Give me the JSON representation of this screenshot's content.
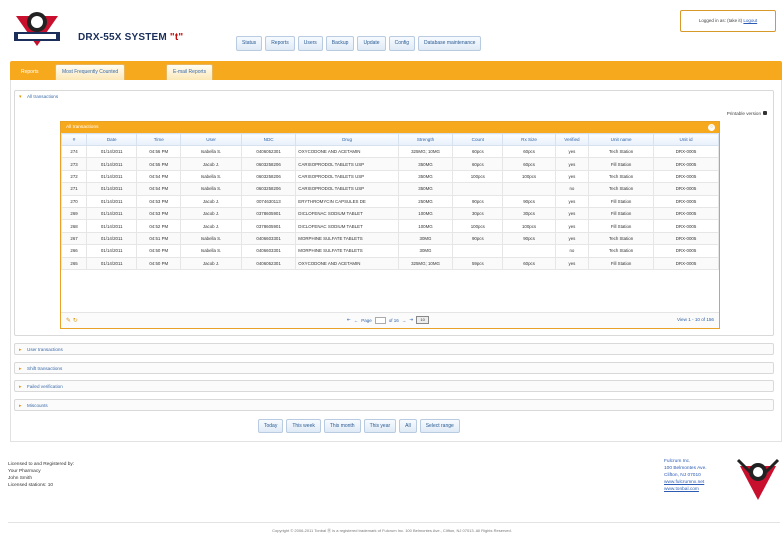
{
  "header": {
    "app_title": "DRX-55X SYSTEM",
    "app_title_mark": "\"t\"",
    "nav": [
      "Status",
      "Reports",
      "Users",
      "Backup",
      "Update",
      "Config",
      "Database maintenance"
    ],
    "login_text": "Logged in as: (take it)",
    "login_link": "Logout"
  },
  "tabs": [
    "Reports",
    "Most Frequently Counted",
    "E-mail Reports"
  ],
  "sections": {
    "open_label": "All transactions",
    "collapsed": [
      "User transactions",
      "Shift transactions",
      "Failed verification",
      "Miscounts"
    ]
  },
  "printable_label": "Printable version",
  "grid": {
    "caption": "All transactions",
    "columns": [
      "#",
      "Date",
      "Time",
      "User",
      "NDC",
      "Drug",
      "Strength",
      "Count",
      "Rx Size",
      "Verified",
      "Unit name",
      "Unit id"
    ],
    "rows": [
      [
        "274",
        "01/14/2011",
        "04:56 PM",
        "Isabella S.",
        "0406052301",
        "OXYCODONE AND ACETAMIN",
        "325MG; 10MG",
        "60pcs",
        "60pcs",
        "yes",
        "Tech Station",
        "DRX-0005"
      ],
      [
        "273",
        "01/14/2011",
        "04:55 PM",
        "Jacob J.",
        "0603258206",
        "CARISOPRODOL TABLETS USP",
        "350MG",
        "60pcs",
        "60pcs",
        "yes",
        "Fill Station",
        "DRX-0005"
      ],
      [
        "272",
        "01/14/2011",
        "04:54 PM",
        "Isabella S.",
        "0603258206",
        "CARISOPRODOL TABLETS USP",
        "350MG",
        "100pcs",
        "100pcs",
        "yes",
        "Tech Station",
        "DRX-0005"
      ],
      [
        "271",
        "01/14/2011",
        "04:54 PM",
        "Isabella S.",
        "0603258206",
        "CARISOPRODOL TABLETS USP",
        "350MG",
        "",
        "",
        "no",
        "Tech Station",
        "DRX-0005"
      ],
      [
        "270",
        "01/14/2011",
        "04:53 PM",
        "Jacob J.",
        "0074630113",
        "ERYTHROMYCIN CAPSULES DE",
        "250MG",
        "90pcs",
        "90pcs",
        "yes",
        "Fill Station",
        "DRX-0005"
      ],
      [
        "269",
        "01/14/2011",
        "04:53 PM",
        "Jacob J.",
        "0378605901",
        "DICLOFENAC SODIUM TABLET",
        "100MG",
        "30pcs",
        "30pcs",
        "yes",
        "Fill Station",
        "DRX-0005"
      ],
      [
        "268",
        "01/14/2011",
        "04:52 PM",
        "Jacob J.",
        "0378605901",
        "DICLOFENAC SODIUM TABLET",
        "100MG",
        "100pcs",
        "100pcs",
        "yes",
        "Fill Station",
        "DRX-0005"
      ],
      [
        "267",
        "01/14/2011",
        "04:51 PM",
        "Isabella S.",
        "0406603301",
        "MORPHINE SULFATE TABLETS",
        "30MG",
        "90pcs",
        "90pcs",
        "yes",
        "Tech Station",
        "DRX-0005"
      ],
      [
        "266",
        "01/14/2011",
        "04:50 PM",
        "Isabella S.",
        "0406603301",
        "MORPHINE SULFATE TABLETS",
        "30MG",
        "",
        "",
        "no",
        "Tech Station",
        "DRX-0005"
      ],
      [
        "265",
        "01/14/2011",
        "04:50 PM",
        "Jacob J.",
        "0406052301",
        "OXYCODONE AND ACETAMIN",
        "325MG; 10MG",
        "59pcs",
        "60pcs",
        "yes",
        "Fill Station",
        "DRX-0005"
      ]
    ],
    "pager": {
      "page_label": "Page",
      "page_value": "1",
      "of_label": "of 16",
      "rows_per_page": "10",
      "view_text": "View 1 - 10 of 156"
    }
  },
  "range_buttons": [
    "Today",
    "This week",
    "This month",
    "This year",
    "All",
    "Select range"
  ],
  "footer": {
    "left": [
      "Licensed to and Registered by:",
      "Your Pharmacy",
      "John Smith",
      "Licensed stations: 10"
    ],
    "right": [
      "Fulcrum Inc.",
      "100 Belmontes Ave.",
      "Clifton, NJ 07010",
      "www.fulcrumnx.net",
      "www.tonbal.com"
    ],
    "copyright": "Copyright © 2006-2011 Tonbal Ⓡ is a registered trademark of Fulcrum Inc. 100 Belmontes Ave., Clifton, NJ 07013. All Rights Reserved."
  },
  "colors": {
    "accent": "#f7a91d",
    "link": "#2b5bb5",
    "yes": "#2aa02a",
    "no": "#d42424"
  }
}
